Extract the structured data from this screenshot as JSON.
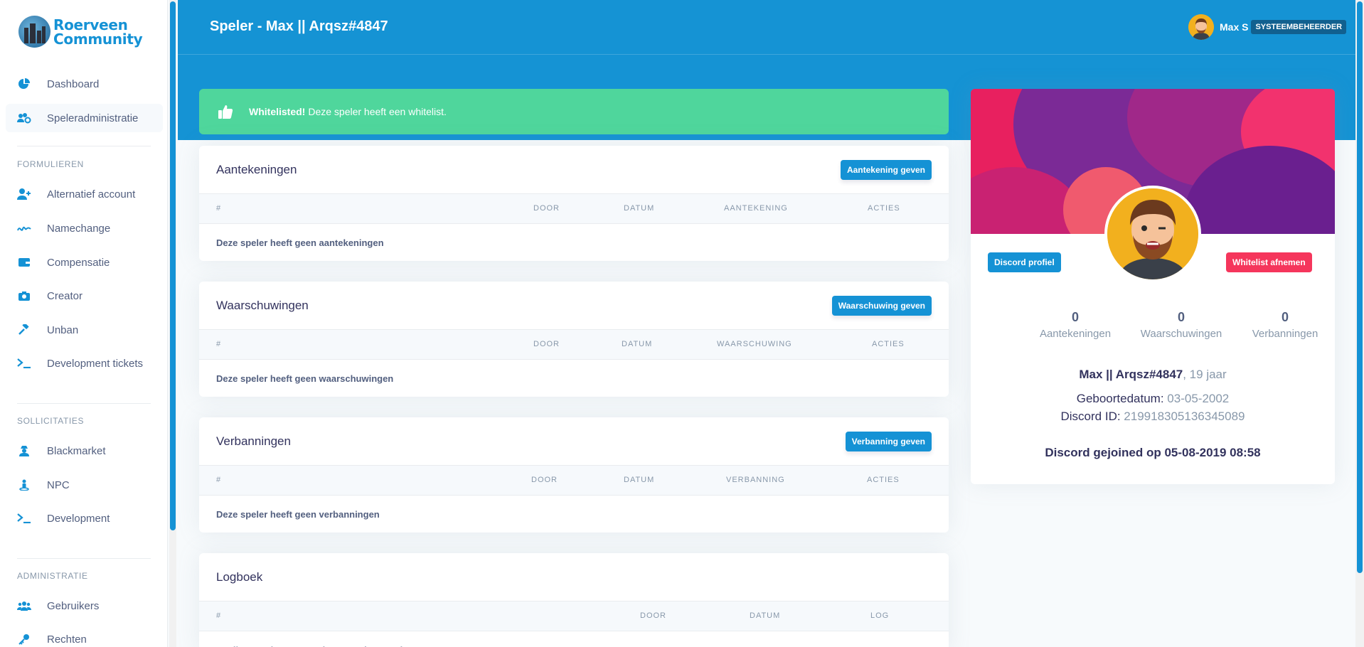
{
  "brand": {
    "line1": "Roerveen",
    "line2": "Community"
  },
  "sidebar": {
    "main": [
      {
        "label": "Dashboard",
        "icon": "pie-chart-icon"
      },
      {
        "label": "Speleradministratie",
        "icon": "users-cog-icon"
      }
    ],
    "section_formulieren": "FORMULIEREN",
    "formulieren": [
      {
        "label": "Alternatief account",
        "icon": "user-plus-icon"
      },
      {
        "label": "Namechange",
        "icon": "signature-icon"
      },
      {
        "label": "Compensatie",
        "icon": "wallet-icon"
      },
      {
        "label": "Creator",
        "icon": "camera-icon"
      },
      {
        "label": "Unban",
        "icon": "gavel-icon"
      },
      {
        "label": "Development tickets",
        "icon": "terminal-icon"
      }
    ],
    "section_sollicitaties": "SOLLICITATIES",
    "sollicitaties": [
      {
        "label": "Blackmarket",
        "icon": "user-secret-icon"
      },
      {
        "label": "NPC",
        "icon": "street-view-icon"
      },
      {
        "label": "Development",
        "icon": "terminal-icon"
      }
    ],
    "section_administratie": "ADMINISTRATIE",
    "administratie": [
      {
        "label": "Gebruikers",
        "icon": "users-icon"
      },
      {
        "label": "Rechten",
        "icon": "key-icon"
      }
    ]
  },
  "header": {
    "title": "Speler - Max || Arqsz#4847",
    "user_name": "Max S",
    "role": "SYSTEEMBEHEERDER"
  },
  "alert": {
    "strong": "Whitelisted!",
    "text": "Deze speler heeft een whitelist."
  },
  "aantekeningen": {
    "title": "Aantekeningen",
    "button": "Aantekening geven",
    "columns": [
      "#",
      "DOOR",
      "DATUM",
      "AANTEKENING",
      "ACTIES"
    ],
    "empty": "Deze speler heeft geen aantekeningen"
  },
  "waarschuwingen": {
    "title": "Waarschuwingen",
    "button": "Waarschuwing geven",
    "columns": [
      "#",
      "DOOR",
      "DATUM",
      "WAARSCHUWING",
      "ACTIES"
    ],
    "empty": "Deze speler heeft geen waarschuwingen"
  },
  "verbanningen": {
    "title": "Verbanningen",
    "button": "Verbanning geven",
    "columns": [
      "#",
      "DOOR",
      "DATUM",
      "VERBANNING",
      "ACTIES"
    ],
    "empty": "Deze speler heeft geen verbanningen"
  },
  "logboek": {
    "title": "Logboek",
    "columns": [
      "#",
      "DOOR",
      "DATUM",
      "LOG"
    ],
    "empty": "Er zijn geen logs gevonden voor deze speler"
  },
  "profile": {
    "discord_button": "Discord profiel",
    "whitelist_button": "Whitelist afnemen",
    "stats": [
      {
        "value": "0",
        "label": "Aantekeningen"
      },
      {
        "value": "0",
        "label": "Waarschuwingen"
      },
      {
        "value": "0",
        "label": "Verbanningen"
      }
    ],
    "name": "Max || Arqsz#4847",
    "age": ", 19 jaar",
    "birth_label": "Geboortedatum: ",
    "birth_value": "03-05-2002",
    "discord_label": "Discord ID: ",
    "discord_value": "219918305136345089",
    "joined": "Discord gejoined op 05-08-2019 08:58"
  }
}
